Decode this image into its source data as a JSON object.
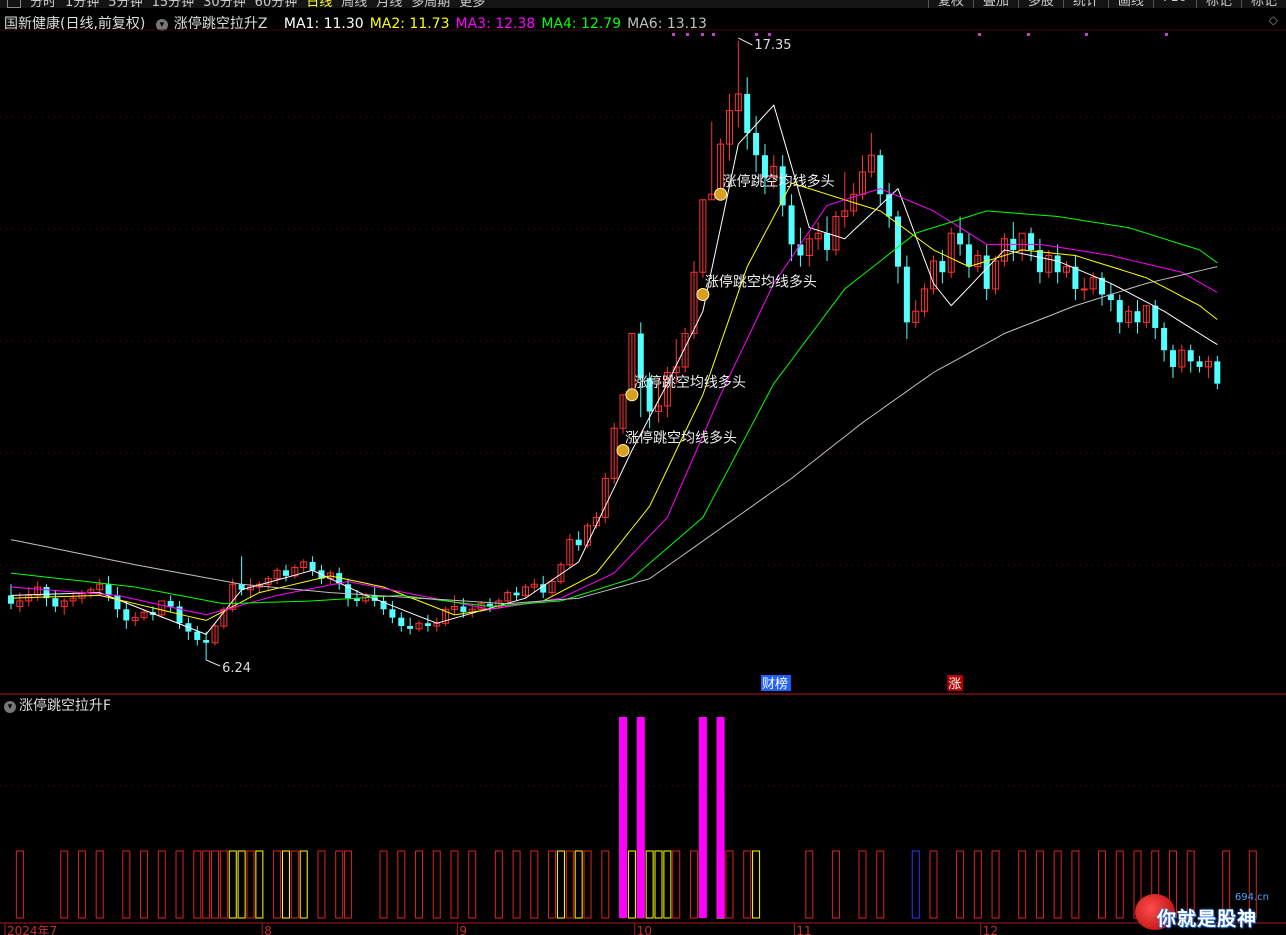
{
  "toolbar": {
    "periods": [
      "分时",
      "1分钟",
      "5分钟",
      "15分钟",
      "30分钟",
      "60分钟",
      "日线",
      "周线",
      "月线",
      "多周期",
      "更多"
    ],
    "active_period": "日线",
    "right_buttons": [
      "复权",
      "叠加",
      "多股",
      "统计",
      "画线",
      "F10",
      "标记",
      "标记"
    ]
  },
  "title": {
    "stock": "国新健康(日线,前复权)",
    "indicator": "涨停跳空拉升Z",
    "ma": [
      {
        "label": "MA1: 11.30",
        "color": "#ffffff"
      },
      {
        "label": "MA2: 11.73",
        "color": "#ffff00"
      },
      {
        "label": "MA3: 12.38",
        "color": "#ff00ff"
      },
      {
        "label": "MA4: 12.79",
        "color": "#00ff00"
      },
      {
        "label": "MA6: 13.13",
        "color": "#c0c0c0"
      }
    ]
  },
  "sub_panel": {
    "title": "涨停跳空拉升F"
  },
  "price_chart": {
    "high_label": "17.35",
    "low_label": "6.24",
    "signal_text": "涨停跳空均线多头",
    "event_tags": [
      "财榜",
      "涨"
    ]
  },
  "axis": {
    "x_labels": [
      "2024年7",
      "8",
      "9",
      "10",
      "11",
      "12"
    ]
  },
  "watermark": {
    "text": "你就是股神",
    "domain": "694.cn"
  },
  "colors": {
    "up": "#ff3232",
    "down": "#54ffff",
    "ma1": "#ffffff",
    "ma2": "#ffff00",
    "ma3": "#ff00ff",
    "ma4": "#00ff00",
    "ma6": "#c0c0c0",
    "magenta_bar": "#ff00ff"
  },
  "chart_data": {
    "type": "candlestick",
    "period": "daily",
    "max_price": 17.35,
    "min_price": 6.24,
    "candles": [
      [
        7.4,
        7.6,
        7.25,
        7.15
      ],
      [
        7.2,
        7.45,
        7.3,
        7.1
      ],
      [
        7.3,
        7.55,
        7.4,
        7.2
      ],
      [
        7.4,
        7.65,
        7.55,
        7.3
      ],
      [
        7.55,
        7.6,
        7.35,
        7.2
      ],
      [
        7.35,
        7.5,
        7.2,
        7.1
      ],
      [
        7.2,
        7.35,
        7.3,
        7.05
      ],
      [
        7.3,
        7.45,
        7.35,
        7.2
      ],
      [
        7.35,
        7.5,
        7.45,
        7.25
      ],
      [
        7.45,
        7.55,
        7.5,
        7.35
      ],
      [
        7.5,
        7.7,
        7.6,
        7.4
      ],
      [
        7.6,
        7.75,
        7.4,
        7.3
      ],
      [
        7.4,
        7.55,
        7.15,
        7.0
      ],
      [
        7.15,
        7.3,
        6.95,
        6.8
      ],
      [
        6.95,
        7.1,
        7.0,
        6.85
      ],
      [
        7.0,
        7.15,
        7.1,
        6.95
      ],
      [
        7.1,
        7.2,
        7.05,
        6.95
      ],
      [
        7.05,
        7.2,
        7.3,
        7.0
      ],
      [
        7.3,
        7.4,
        7.2,
        7.1
      ],
      [
        7.2,
        7.3,
        6.9,
        6.8
      ],
      [
        6.9,
        7.0,
        6.75,
        6.6
      ],
      [
        6.75,
        6.85,
        6.6,
        6.5
      ],
      [
        6.6,
        6.75,
        6.55,
        6.24
      ],
      [
        6.55,
        6.9,
        6.85,
        6.5
      ],
      [
        6.85,
        7.2,
        7.15,
        6.8
      ],
      [
        7.15,
        7.7,
        7.6,
        7.1
      ],
      [
        7.6,
        8.1,
        7.5,
        7.4
      ],
      [
        7.5,
        7.7,
        7.55,
        7.35
      ],
      [
        7.55,
        7.65,
        7.6,
        7.45
      ],
      [
        7.6,
        7.75,
        7.7,
        7.5
      ],
      [
        7.7,
        7.9,
        7.85,
        7.6
      ],
      [
        7.85,
        7.95,
        7.75,
        7.65
      ],
      [
        7.75,
        7.95,
        7.9,
        7.7
      ],
      [
        7.9,
        8.05,
        8.0,
        7.8
      ],
      [
        8.0,
        8.1,
        7.85,
        7.75
      ],
      [
        7.85,
        7.95,
        7.7,
        7.6
      ],
      [
        7.7,
        7.85,
        7.8,
        7.6
      ],
      [
        7.8,
        7.9,
        7.6,
        7.5
      ],
      [
        7.6,
        7.7,
        7.35,
        7.2
      ],
      [
        7.35,
        7.5,
        7.3,
        7.2
      ],
      [
        7.3,
        7.45,
        7.4,
        7.25
      ],
      [
        7.4,
        7.55,
        7.3,
        7.2
      ],
      [
        7.3,
        7.4,
        7.15,
        7.05
      ],
      [
        7.15,
        7.3,
        7.0,
        6.9
      ],
      [
        7.0,
        7.1,
        6.85,
        6.75
      ],
      [
        6.85,
        7.0,
        6.8,
        6.7
      ],
      [
        6.8,
        6.95,
        6.9,
        6.75
      ],
      [
        6.9,
        7.05,
        6.85,
        6.75
      ],
      [
        6.85,
        7.0,
        6.9,
        6.75
      ],
      [
        6.9,
        7.2,
        7.15,
        6.85
      ],
      [
        7.15,
        7.4,
        7.2,
        7.05
      ],
      [
        7.2,
        7.35,
        7.1,
        7.0
      ],
      [
        7.1,
        7.25,
        7.15,
        7.0
      ],
      [
        7.15,
        7.3,
        7.25,
        7.1
      ],
      [
        7.25,
        7.35,
        7.2,
        7.1
      ],
      [
        7.2,
        7.35,
        7.3,
        7.15
      ],
      [
        7.3,
        7.5,
        7.45,
        7.25
      ],
      [
        7.45,
        7.55,
        7.4,
        7.3
      ],
      [
        7.4,
        7.6,
        7.55,
        7.35
      ],
      [
        7.55,
        7.7,
        7.6,
        7.45
      ],
      [
        7.6,
        7.75,
        7.45,
        7.35
      ],
      [
        7.45,
        7.7,
        7.65,
        7.4
      ],
      [
        7.65,
        8.0,
        7.95,
        7.6
      ],
      [
        7.95,
        8.5,
        8.4,
        7.9
      ],
      [
        8.4,
        8.55,
        8.3,
        8.2
      ],
      [
        8.3,
        8.7,
        8.65,
        8.25
      ],
      [
        8.65,
        8.9,
        8.8,
        8.6
      ],
      [
        8.8,
        9.6,
        9.5,
        8.7
      ],
      [
        9.5,
        10.5,
        10.4,
        9.4
      ],
      [
        10.4,
        11.0,
        11.0,
        10.3
      ],
      [
        11.0,
        12.1,
        12.1,
        10.9
      ],
      [
        12.1,
        12.3,
        11.3,
        10.6
      ],
      [
        11.3,
        11.4,
        10.7,
        10.4
      ],
      [
        10.7,
        11.3,
        10.8,
        10.5
      ],
      [
        10.8,
        11.5,
        11.4,
        10.6
      ],
      [
        11.4,
        12.0,
        11.5,
        11.2
      ],
      [
        11.5,
        12.2,
        12.1,
        11.4
      ],
      [
        12.1,
        13.4,
        13.2,
        12.0
      ],
      [
        13.2,
        14.5,
        14.5,
        13.1
      ],
      [
        14.5,
        15.9,
        14.6,
        14.5
      ],
      [
        14.6,
        15.6,
        15.5,
        14.5
      ],
      [
        15.5,
        16.4,
        16.1,
        15.2
      ],
      [
        16.1,
        17.35,
        16.4,
        15.8
      ],
      [
        16.4,
        16.7,
        15.7,
        15.4
      ],
      [
        15.7,
        16.0,
        15.3,
        15.0
      ],
      [
        15.3,
        15.5,
        14.9,
        14.6
      ],
      [
        14.9,
        15.3,
        15.1,
        14.7
      ],
      [
        15.1,
        15.3,
        14.4,
        14.2
      ],
      [
        14.4,
        14.6,
        13.7,
        13.4
      ],
      [
        13.7,
        14.0,
        13.5,
        13.3
      ],
      [
        13.5,
        13.9,
        13.8,
        13.3
      ],
      [
        13.8,
        14.1,
        13.9,
        13.6
      ],
      [
        13.9,
        14.2,
        13.6,
        13.4
      ],
      [
        13.6,
        14.3,
        14.2,
        13.5
      ],
      [
        14.2,
        15.0,
        14.3,
        14.0
      ],
      [
        14.3,
        14.8,
        14.6,
        14.2
      ],
      [
        14.6,
        15.3,
        15.0,
        14.5
      ],
      [
        15.0,
        15.7,
        15.3,
        14.9
      ],
      [
        15.3,
        15.4,
        14.6,
        14.4
      ],
      [
        14.6,
        14.8,
        14.2,
        14.0
      ],
      [
        14.2,
        14.3,
        13.3,
        13.0
      ],
      [
        13.3,
        13.5,
        12.3,
        12.0
      ],
      [
        12.3,
        12.7,
        12.5,
        12.2
      ],
      [
        12.5,
        13.0,
        12.9,
        12.4
      ],
      [
        12.9,
        13.5,
        13.4,
        12.8
      ],
      [
        13.4,
        13.6,
        13.2,
        13.0
      ],
      [
        13.2,
        14.0,
        13.9,
        13.1
      ],
      [
        13.9,
        14.2,
        13.7,
        13.5
      ],
      [
        13.7,
        13.9,
        13.3,
        13.1
      ],
      [
        13.3,
        13.6,
        13.5,
        13.2
      ],
      [
        13.5,
        13.7,
        12.9,
        12.7
      ],
      [
        12.9,
        13.5,
        13.4,
        12.8
      ],
      [
        13.4,
        13.9,
        13.8,
        13.3
      ],
      [
        13.8,
        14.1,
        13.6,
        13.4
      ],
      [
        13.6,
        13.8,
        13.9,
        13.4
      ],
      [
        13.9,
        14.0,
        13.6,
        13.4
      ],
      [
        13.6,
        13.8,
        13.2,
        13.0
      ],
      [
        13.2,
        13.6,
        13.5,
        13.1
      ],
      [
        13.5,
        13.7,
        13.2,
        13.0
      ],
      [
        13.2,
        13.4,
        13.3,
        13.1
      ],
      [
        13.3,
        13.5,
        12.9,
        12.7
      ],
      [
        12.9,
        13.1,
        12.9,
        12.7
      ],
      [
        12.9,
        13.2,
        13.1,
        12.8
      ],
      [
        13.1,
        13.2,
        12.8,
        12.6
      ],
      [
        12.8,
        13.0,
        12.7,
        12.5
      ],
      [
        12.7,
        12.8,
        12.3,
        12.1
      ],
      [
        12.3,
        12.6,
        12.5,
        12.2
      ],
      [
        12.5,
        12.7,
        12.3,
        12.1
      ],
      [
        12.3,
        12.6,
        12.6,
        12.2
      ],
      [
        12.6,
        12.7,
        12.2,
        12.0
      ],
      [
        12.2,
        12.3,
        11.8,
        11.6
      ],
      [
        11.8,
        11.9,
        11.5,
        11.3
      ],
      [
        11.5,
        11.9,
        11.8,
        11.4
      ],
      [
        11.8,
        11.9,
        11.6,
        11.4
      ],
      [
        11.6,
        11.7,
        11.5,
        11.4
      ],
      [
        11.5,
        11.7,
        11.6,
        11.3
      ],
      [
        11.6,
        11.7,
        11.2,
        11.1
      ]
    ],
    "ma_series": [
      {
        "name": "MA1",
        "color": "#ffffff",
        "anchors": [
          [
            0,
            7.4
          ],
          [
            10,
            7.45
          ],
          [
            22,
            6.7
          ],
          [
            26,
            7.5
          ],
          [
            34,
            7.85
          ],
          [
            40,
            7.4
          ],
          [
            48,
            6.9
          ],
          [
            58,
            7.35
          ],
          [
            64,
            8.0
          ],
          [
            70,
            10.0
          ],
          [
            74,
            11.2
          ],
          [
            78,
            12.5
          ],
          [
            82,
            15.5
          ],
          [
            86,
            16.2
          ],
          [
            90,
            14.0
          ],
          [
            94,
            13.8
          ],
          [
            100,
            14.7
          ],
          [
            104,
            13.0
          ],
          [
            106,
            12.6
          ],
          [
            112,
            13.6
          ],
          [
            118,
            13.4
          ],
          [
            124,
            13.0
          ],
          [
            130,
            12.5
          ],
          [
            136,
            11.9
          ],
          [
            141,
            11.3
          ]
        ]
      },
      {
        "name": "MA2",
        "color": "#ffff00",
        "anchors": [
          [
            0,
            7.35
          ],
          [
            10,
            7.4
          ],
          [
            22,
            6.95
          ],
          [
            28,
            7.45
          ],
          [
            36,
            7.75
          ],
          [
            42,
            7.55
          ],
          [
            50,
            7.05
          ],
          [
            60,
            7.3
          ],
          [
            66,
            7.8
          ],
          [
            72,
            9.0
          ],
          [
            78,
            11.0
          ],
          [
            83,
            13.3
          ],
          [
            88,
            14.8
          ],
          [
            92,
            14.6
          ],
          [
            98,
            14.3
          ],
          [
            104,
            13.6
          ],
          [
            108,
            13.3
          ],
          [
            114,
            13.6
          ],
          [
            120,
            13.5
          ],
          [
            128,
            13.1
          ],
          [
            134,
            12.6
          ],
          [
            141,
            11.73
          ]
        ]
      },
      {
        "name": "MA3",
        "color": "#ff00ff",
        "anchors": [
          [
            0,
            7.55
          ],
          [
            12,
            7.4
          ],
          [
            22,
            7.05
          ],
          [
            30,
            7.4
          ],
          [
            38,
            7.65
          ],
          [
            46,
            7.4
          ],
          [
            54,
            7.15
          ],
          [
            62,
            7.35
          ],
          [
            68,
            7.8
          ],
          [
            74,
            8.8
          ],
          [
            80,
            11.0
          ],
          [
            86,
            13.0
          ],
          [
            92,
            14.4
          ],
          [
            98,
            14.7
          ],
          [
            104,
            14.3
          ],
          [
            110,
            13.7
          ],
          [
            116,
            13.7
          ],
          [
            124,
            13.5
          ],
          [
            132,
            13.2
          ],
          [
            141,
            12.38
          ]
        ]
      },
      {
        "name": "MA4",
        "color": "#00ff00",
        "anchors": [
          [
            0,
            7.8
          ],
          [
            14,
            7.55
          ],
          [
            24,
            7.25
          ],
          [
            34,
            7.3
          ],
          [
            44,
            7.4
          ],
          [
            54,
            7.2
          ],
          [
            62,
            7.3
          ],
          [
            70,
            7.7
          ],
          [
            78,
            8.8
          ],
          [
            86,
            11.2
          ],
          [
            94,
            12.9
          ],
          [
            102,
            13.9
          ],
          [
            110,
            14.3
          ],
          [
            118,
            14.2
          ],
          [
            126,
            14.0
          ],
          [
            134,
            13.6
          ],
          [
            141,
            12.79
          ]
        ]
      },
      {
        "name": "MA6",
        "color": "#c0c0c0",
        "anchors": [
          [
            0,
            8.4
          ],
          [
            14,
            7.95
          ],
          [
            26,
            7.6
          ],
          [
            36,
            7.45
          ],
          [
            46,
            7.35
          ],
          [
            56,
            7.25
          ],
          [
            64,
            7.35
          ],
          [
            72,
            7.7
          ],
          [
            80,
            8.6
          ],
          [
            88,
            9.5
          ],
          [
            96,
            10.5
          ],
          [
            104,
            11.4
          ],
          [
            112,
            12.1
          ],
          [
            120,
            12.6
          ],
          [
            128,
            13.0
          ],
          [
            136,
            13.3
          ],
          [
            141,
            13.13
          ]
        ]
      }
    ],
    "high": {
      "index": 82,
      "value": 17.35
    },
    "low": {
      "index": 22,
      "value": 6.24
    },
    "signals": [
      {
        "index": 69,
        "price": 10.0,
        "text": "涨停跳空均线多头"
      },
      {
        "index": 70,
        "price": 11.0,
        "text": "涨停跳空均线多头"
      },
      {
        "index": 78,
        "price": 12.8,
        "text": "涨停跳空均线多头"
      },
      {
        "index": 80,
        "price": 14.6,
        "text": "涨停跳空均线多头"
      }
    ],
    "events": [
      {
        "index": 85,
        "text": "财榜",
        "color": "#2060ff"
      },
      {
        "index": 106,
        "text": "涨",
        "color": "#b00000"
      }
    ],
    "x_labels": [
      {
        "index": 0,
        "text": "2024年7"
      },
      {
        "index": 29,
        "text": "8"
      },
      {
        "index": 51,
        "text": "9"
      },
      {
        "index": 71,
        "text": "10"
      },
      {
        "index": 89,
        "text": "11"
      },
      {
        "index": 110,
        "text": "12"
      }
    ],
    "sub_indicator": {
      "name": "涨停跳空拉升F",
      "red_bars": [
        1,
        6,
        8,
        10,
        13,
        15,
        17,
        19,
        21,
        22,
        23,
        24,
        27,
        30,
        32,
        35,
        37,
        38,
        42,
        44,
        46,
        48,
        50,
        52,
        55,
        57,
        59,
        61,
        63,
        65,
        67,
        71,
        75,
        77,
        81,
        83,
        90,
        93,
        96,
        98,
        104,
        107,
        109,
        111,
        114,
        116,
        118,
        120,
        123,
        125,
        127,
        129,
        131,
        133,
        137,
        140
      ],
      "yellow_bars": [
        25,
        26,
        28,
        31,
        33,
        62,
        64,
        70,
        72,
        73,
        74,
        80,
        84
      ],
      "blue_bars": [
        102
      ],
      "magenta_bars": [
        69,
        71,
        78,
        80
      ]
    }
  }
}
